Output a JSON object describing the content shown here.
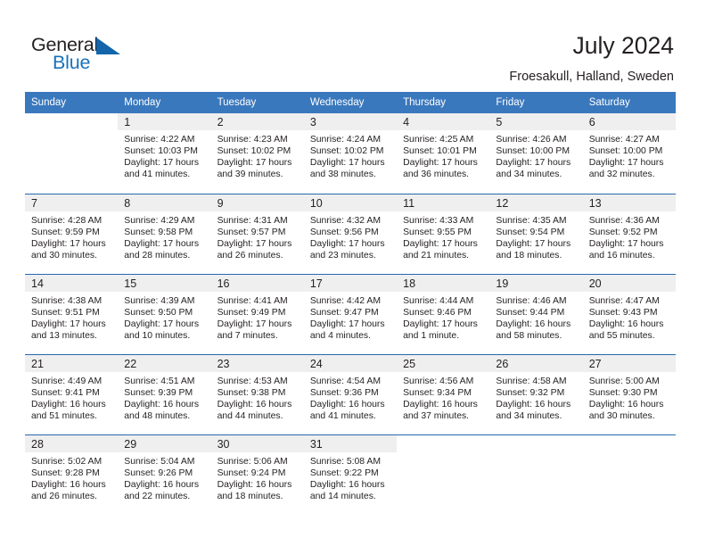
{
  "brand": {
    "word_one": "General",
    "word_two": "Blue",
    "triangle_color": "#1265ab",
    "blue_color": "#1a72ba"
  },
  "header": {
    "title": "July 2024",
    "location": "Froesakull, Halland, Sweden"
  },
  "theme": {
    "header_bg": "#3a78bd",
    "header_text": "#ffffff",
    "daynum_bg": "#efefef",
    "row_rule": "#2768ae",
    "body_text": "#231f20"
  },
  "weekday_headers": [
    "Sunday",
    "Monday",
    "Tuesday",
    "Wednesday",
    "Thursday",
    "Friday",
    "Saturday"
  ],
  "weeks": [
    [
      {
        "day": "",
        "sunrise": "",
        "sunset": "",
        "daylight": "",
        "empty": true
      },
      {
        "day": "1",
        "sunrise": "Sunrise: 4:22 AM",
        "sunset": "Sunset: 10:03 PM",
        "daylight": "Daylight: 17 hours and 41 minutes."
      },
      {
        "day": "2",
        "sunrise": "Sunrise: 4:23 AM",
        "sunset": "Sunset: 10:02 PM",
        "daylight": "Daylight: 17 hours and 39 minutes."
      },
      {
        "day": "3",
        "sunrise": "Sunrise: 4:24 AM",
        "sunset": "Sunset: 10:02 PM",
        "daylight": "Daylight: 17 hours and 38 minutes."
      },
      {
        "day": "4",
        "sunrise": "Sunrise: 4:25 AM",
        "sunset": "Sunset: 10:01 PM",
        "daylight": "Daylight: 17 hours and 36 minutes."
      },
      {
        "day": "5",
        "sunrise": "Sunrise: 4:26 AM",
        "sunset": "Sunset: 10:00 PM",
        "daylight": "Daylight: 17 hours and 34 minutes."
      },
      {
        "day": "6",
        "sunrise": "Sunrise: 4:27 AM",
        "sunset": "Sunset: 10:00 PM",
        "daylight": "Daylight: 17 hours and 32 minutes."
      }
    ],
    [
      {
        "day": "7",
        "sunrise": "Sunrise: 4:28 AM",
        "sunset": "Sunset: 9:59 PM",
        "daylight": "Daylight: 17 hours and 30 minutes."
      },
      {
        "day": "8",
        "sunrise": "Sunrise: 4:29 AM",
        "sunset": "Sunset: 9:58 PM",
        "daylight": "Daylight: 17 hours and 28 minutes."
      },
      {
        "day": "9",
        "sunrise": "Sunrise: 4:31 AM",
        "sunset": "Sunset: 9:57 PM",
        "daylight": "Daylight: 17 hours and 26 minutes."
      },
      {
        "day": "10",
        "sunrise": "Sunrise: 4:32 AM",
        "sunset": "Sunset: 9:56 PM",
        "daylight": "Daylight: 17 hours and 23 minutes."
      },
      {
        "day": "11",
        "sunrise": "Sunrise: 4:33 AM",
        "sunset": "Sunset: 9:55 PM",
        "daylight": "Daylight: 17 hours and 21 minutes."
      },
      {
        "day": "12",
        "sunrise": "Sunrise: 4:35 AM",
        "sunset": "Sunset: 9:54 PM",
        "daylight": "Daylight: 17 hours and 18 minutes."
      },
      {
        "day": "13",
        "sunrise": "Sunrise: 4:36 AM",
        "sunset": "Sunset: 9:52 PM",
        "daylight": "Daylight: 17 hours and 16 minutes."
      }
    ],
    [
      {
        "day": "14",
        "sunrise": "Sunrise: 4:38 AM",
        "sunset": "Sunset: 9:51 PM",
        "daylight": "Daylight: 17 hours and 13 minutes."
      },
      {
        "day": "15",
        "sunrise": "Sunrise: 4:39 AM",
        "sunset": "Sunset: 9:50 PM",
        "daylight": "Daylight: 17 hours and 10 minutes."
      },
      {
        "day": "16",
        "sunrise": "Sunrise: 4:41 AM",
        "sunset": "Sunset: 9:49 PM",
        "daylight": "Daylight: 17 hours and 7 minutes."
      },
      {
        "day": "17",
        "sunrise": "Sunrise: 4:42 AM",
        "sunset": "Sunset: 9:47 PM",
        "daylight": "Daylight: 17 hours and 4 minutes."
      },
      {
        "day": "18",
        "sunrise": "Sunrise: 4:44 AM",
        "sunset": "Sunset: 9:46 PM",
        "daylight": "Daylight: 17 hours and 1 minute."
      },
      {
        "day": "19",
        "sunrise": "Sunrise: 4:46 AM",
        "sunset": "Sunset: 9:44 PM",
        "daylight": "Daylight: 16 hours and 58 minutes."
      },
      {
        "day": "20",
        "sunrise": "Sunrise: 4:47 AM",
        "sunset": "Sunset: 9:43 PM",
        "daylight": "Daylight: 16 hours and 55 minutes."
      }
    ],
    [
      {
        "day": "21",
        "sunrise": "Sunrise: 4:49 AM",
        "sunset": "Sunset: 9:41 PM",
        "daylight": "Daylight: 16 hours and 51 minutes."
      },
      {
        "day": "22",
        "sunrise": "Sunrise: 4:51 AM",
        "sunset": "Sunset: 9:39 PM",
        "daylight": "Daylight: 16 hours and 48 minutes."
      },
      {
        "day": "23",
        "sunrise": "Sunrise: 4:53 AM",
        "sunset": "Sunset: 9:38 PM",
        "daylight": "Daylight: 16 hours and 44 minutes."
      },
      {
        "day": "24",
        "sunrise": "Sunrise: 4:54 AM",
        "sunset": "Sunset: 9:36 PM",
        "daylight": "Daylight: 16 hours and 41 minutes."
      },
      {
        "day": "25",
        "sunrise": "Sunrise: 4:56 AM",
        "sunset": "Sunset: 9:34 PM",
        "daylight": "Daylight: 16 hours and 37 minutes."
      },
      {
        "day": "26",
        "sunrise": "Sunrise: 4:58 AM",
        "sunset": "Sunset: 9:32 PM",
        "daylight": "Daylight: 16 hours and 34 minutes."
      },
      {
        "day": "27",
        "sunrise": "Sunrise: 5:00 AM",
        "sunset": "Sunset: 9:30 PM",
        "daylight": "Daylight: 16 hours and 30 minutes."
      }
    ],
    [
      {
        "day": "28",
        "sunrise": "Sunrise: 5:02 AM",
        "sunset": "Sunset: 9:28 PM",
        "daylight": "Daylight: 16 hours and 26 minutes."
      },
      {
        "day": "29",
        "sunrise": "Sunrise: 5:04 AM",
        "sunset": "Sunset: 9:26 PM",
        "daylight": "Daylight: 16 hours and 22 minutes."
      },
      {
        "day": "30",
        "sunrise": "Sunrise: 5:06 AM",
        "sunset": "Sunset: 9:24 PM",
        "daylight": "Daylight: 16 hours and 18 minutes."
      },
      {
        "day": "31",
        "sunrise": "Sunrise: 5:08 AM",
        "sunset": "Sunset: 9:22 PM",
        "daylight": "Daylight: 16 hours and 14 minutes."
      },
      {
        "day": "",
        "sunrise": "",
        "sunset": "",
        "daylight": "",
        "empty": true
      },
      {
        "day": "",
        "sunrise": "",
        "sunset": "",
        "daylight": "",
        "empty": true
      },
      {
        "day": "",
        "sunrise": "",
        "sunset": "",
        "daylight": "",
        "empty": true
      }
    ]
  ]
}
